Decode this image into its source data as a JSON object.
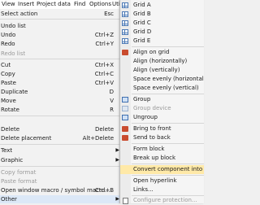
{
  "menubar": {
    "items": [
      "View",
      "Insert",
      "Project data",
      "Find",
      "Options",
      "Utilities"
    ]
  },
  "left_menu": {
    "items": [
      {
        "label": "Select action",
        "shortcut": "Esc",
        "disabled": false
      },
      {
        "label": "Undo list",
        "shortcut": "",
        "disabled": false
      },
      {
        "label": "Undo",
        "shortcut": "Ctrl+Z",
        "disabled": false
      },
      {
        "label": "Redo",
        "shortcut": "Ctrl+Y",
        "disabled": false
      },
      {
        "label": "Redo list",
        "shortcut": "",
        "disabled": true
      },
      {
        "label": "Cut",
        "shortcut": "Ctrl+X",
        "disabled": false
      },
      {
        "label": "Copy",
        "shortcut": "Ctrl+C",
        "disabled": false
      },
      {
        "label": "Paste",
        "shortcut": "Ctrl+V",
        "disabled": false
      },
      {
        "label": "Duplicate",
        "shortcut": "D",
        "disabled": false
      },
      {
        "label": "Move",
        "shortcut": "V",
        "disabled": false
      },
      {
        "label": "Rotate",
        "shortcut": "R",
        "disabled": false
      },
      {
        "label": "Delete",
        "shortcut": "Delete",
        "disabled": false
      },
      {
        "label": "Delete placement",
        "shortcut": "Alt+Delete",
        "disabled": false
      },
      {
        "label": "Text",
        "shortcut": "",
        "disabled": false
      },
      {
        "label": "Graphic",
        "shortcut": "",
        "disabled": false
      },
      {
        "label": "Copy format",
        "shortcut": "",
        "disabled": true
      },
      {
        "label": "Paste format",
        "shortcut": "",
        "disabled": true
      },
      {
        "label": "Open window macro / symbol macro...",
        "shortcut": "Ctrl+B",
        "disabled": false
      },
      {
        "label": "Other",
        "shortcut": "",
        "disabled": false
      }
    ]
  },
  "submenu": {
    "items": [
      "Grid A",
      "Grid B",
      "Grid C",
      "Grid D",
      "Grid E",
      "Align on grid",
      "Align (horizontally)",
      "Align (vertically)",
      "Space evenly (horizontal)",
      "Space evenly (vertical)",
      "Group",
      "Group device",
      "Ungroup",
      "Bring to front",
      "Send to back",
      "Form block",
      "Break up block",
      "Convert component into graphic",
      "Open hyperlink",
      "Links...",
      "Configure protection..."
    ]
  },
  "colors": {
    "highlight": "#ffe9a8",
    "left_highlight": "#dce8f7",
    "icon_blue": "#4a78b5",
    "icon_red": "#c94b2e"
  }
}
